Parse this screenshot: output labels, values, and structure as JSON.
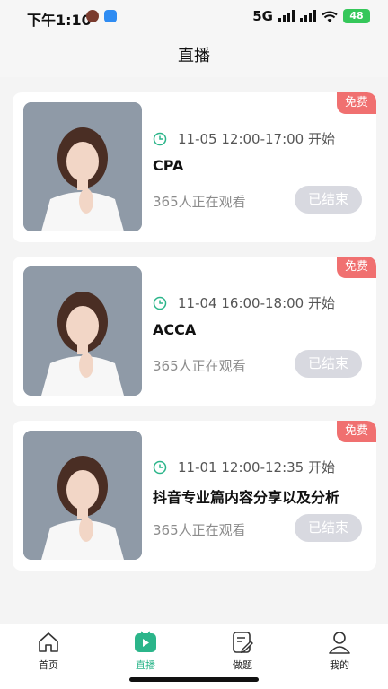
{
  "status": {
    "time": "下午1:10",
    "network": "5G",
    "battery": "48"
  },
  "header": {
    "title": "直播"
  },
  "cards": [
    {
      "badge": "免费",
      "time": "11-05 12:00-17:00 开始",
      "title": "CPA",
      "viewers": "365人正在观看",
      "button": "已结束"
    },
    {
      "badge": "免费",
      "time": "11-04 16:00-18:00 开始",
      "title": "ACCA",
      "viewers": "365人正在观看",
      "button": "已结束"
    },
    {
      "badge": "免费",
      "time": "11-01 12:00-12:35 开始",
      "title": "抖音专业篇内容分享以及分析",
      "viewers": "365人正在观看",
      "button": "已结束"
    }
  ],
  "tabs": [
    {
      "label": "首页",
      "icon": "home-icon"
    },
    {
      "label": "直播",
      "icon": "live-icon"
    },
    {
      "label": "做题",
      "icon": "practice-icon"
    },
    {
      "label": "我的",
      "icon": "profile-icon"
    }
  ],
  "colors": {
    "accent": "#2bb58a",
    "badge": "#f07070",
    "ended_button": "#d8d9e0"
  }
}
